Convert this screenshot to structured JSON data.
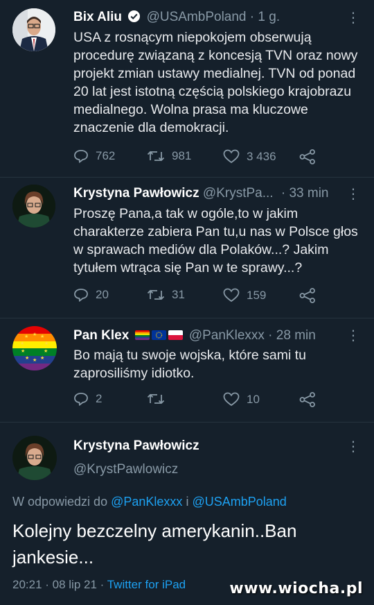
{
  "tweets": [
    {
      "name": "Bix Aliu",
      "handle": "@USAmbPoland",
      "time": "· 1 g.",
      "more": "⋮",
      "text": "USA z rosnącym niepokojem obserwują procedurę związaną z koncesją TVN oraz nowy projekt zmian ustawy medialnej. TVN od ponad 20 lat jest istotną częścią polskiego krajobrazu medialnego. Wolna prasa ma kluczowe znaczenie dla demokracji.",
      "replies": "762",
      "retweets": "981",
      "likes": "3 436"
    },
    {
      "name": "Krystyna Pawłowicz",
      "handle": "@KrystPa...",
      "time": "· 33 min",
      "more": "⋮",
      "text": "Proszę Pana,a tak w ogóle,to w jakim charakterze zabiera Pan tu,u nas w Polsce głos w sprawach mediów dla Polaków...? Jakim tytułem wtrąca się Pan w te sprawy...?",
      "replies": "20",
      "retweets": "31",
      "likes": "159"
    },
    {
      "name": "Pan Klex",
      "handle": "@PanKlexxx",
      "time": "· 28 min",
      "more": "⋮",
      "text": "Bo mają tu swoje wojska, które sami tu zaprosiliśmy idiotko.",
      "replies": "2",
      "retweets": "",
      "likes": "10"
    }
  ],
  "main": {
    "name": "Krystyna Pawłowicz",
    "handle": "@KrystPawlowicz",
    "more": "⋮",
    "reply_prefix": "W odpowiedzi do",
    "reply_user1": "@PanKlexxx",
    "reply_and": "i",
    "reply_user2": "@USAmbPoland",
    "text": "Kolejny bezczelny  amerykanin..Ban jankesie...",
    "datetime": "20:21 · 08 lip 21 ·",
    "client": "Twitter for iPad"
  },
  "watermark": {
    "prefix": "www.",
    "name": "wiocha",
    "suffix": ".pl"
  },
  "colors": {
    "background": "#15202b",
    "muted": "#8899a6",
    "link": "#1da1f2"
  }
}
